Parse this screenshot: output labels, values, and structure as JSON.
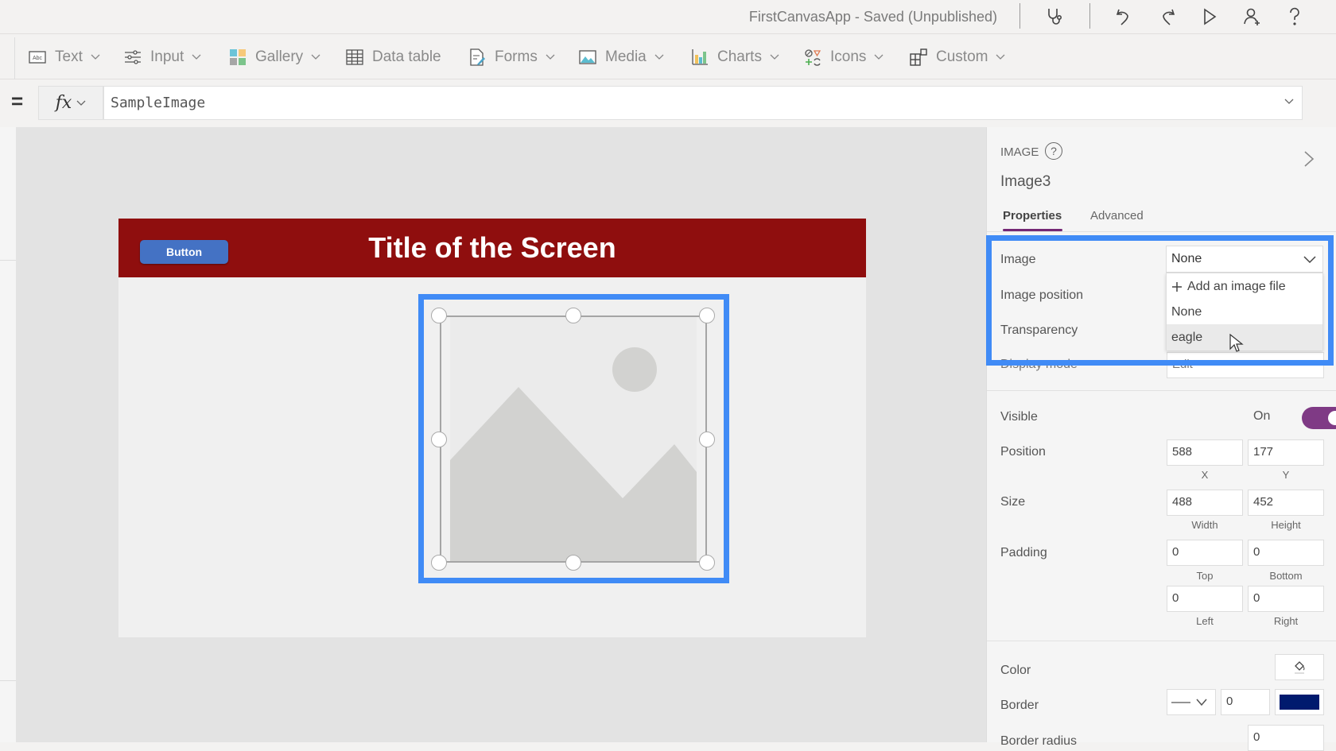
{
  "topbar": {
    "app_title": "FirstCanvasApp - Saved (Unpublished)",
    "icons": [
      "app-checker-icon",
      "undo-icon",
      "redo-icon",
      "play-icon",
      "share-icon",
      "help-icon"
    ]
  },
  "toolbar": {
    "items": [
      {
        "label": "Text",
        "icon": "text-label-icon",
        "dropdown": true
      },
      {
        "label": "Input",
        "icon": "input-sliders-icon",
        "dropdown": true
      },
      {
        "label": "Gallery",
        "icon": "gallery-icon",
        "dropdown": true
      },
      {
        "label": "Data table",
        "icon": "data-table-icon",
        "dropdown": false
      },
      {
        "label": "Forms",
        "icon": "forms-icon",
        "dropdown": true
      },
      {
        "label": "Media",
        "icon": "media-icon",
        "dropdown": true
      },
      {
        "label": "Charts",
        "icon": "charts-icon",
        "dropdown": true
      },
      {
        "label": "Icons",
        "icon": "icons-icon",
        "dropdown": true
      },
      {
        "label": "Custom",
        "icon": "custom-icon",
        "dropdown": true
      }
    ]
  },
  "formula_bar": {
    "equals": "=",
    "fx_label": "fx",
    "formula": "SampleImage"
  },
  "canvas": {
    "button_label": "Button",
    "screen_title": "Title of the Screen",
    "colors": {
      "header": "#8f0e0e",
      "button": "#4472c4",
      "selection": "#408bf6"
    }
  },
  "panel": {
    "control_type": "IMAGE",
    "help": "?",
    "control_name": "Image3",
    "tabs": [
      {
        "label": "Properties",
        "active": true
      },
      {
        "label": "Advanced",
        "active": false
      }
    ],
    "image": {
      "label": "Image",
      "value": "None",
      "options": [
        {
          "label": "Add an image file",
          "icon": "plus-icon"
        },
        {
          "label": "None"
        },
        {
          "label": "eagle",
          "hovered": true
        }
      ]
    },
    "image_position_label": "Image position",
    "transparency_label": "Transparency",
    "display_mode": {
      "label": "Display mode",
      "value": "Edit"
    },
    "visible": {
      "label": "Visible",
      "state": "On",
      "on": true
    },
    "position": {
      "label": "Position",
      "x": "588",
      "y": "177",
      "x_label": "X",
      "y_label": "Y"
    },
    "size": {
      "label": "Size",
      "width": "488",
      "height": "452",
      "width_label": "Width",
      "height_label": "Height"
    },
    "padding": {
      "label": "Padding",
      "top": "0",
      "bottom": "0",
      "left": "0",
      "right": "0",
      "top_label": "Top",
      "bottom_label": "Bottom",
      "left_label": "Left",
      "right_label": "Right"
    },
    "color_label": "Color",
    "border": {
      "label": "Border",
      "width": "0",
      "color": "#001a6e"
    },
    "border_radius": {
      "label": "Border radius",
      "value": "0"
    },
    "accent": "#742774",
    "toggle_color": "#7f3a85"
  }
}
